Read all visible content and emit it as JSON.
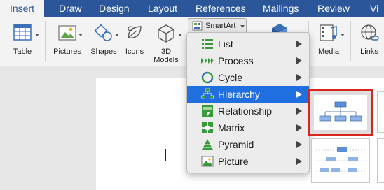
{
  "ribbon_tabs": [
    "Insert",
    "Draw",
    "Design",
    "Layout",
    "References",
    "Mailings",
    "Review",
    "Vi"
  ],
  "ribbon_buttons": {
    "table": "Table",
    "pictures": "Pictures",
    "shapes": "Shapes",
    "icons": "Icons",
    "models_line1": "3D",
    "models_line2": "Models",
    "media": "Media",
    "links": "Links"
  },
  "smartart_button": "SmartArt",
  "smartart_menu": {
    "selected": "Hierarchy",
    "items": [
      {
        "label": "List",
        "icon": "list-icon"
      },
      {
        "label": "Process",
        "icon": "process-icon"
      },
      {
        "label": "Cycle",
        "icon": "cycle-icon"
      },
      {
        "label": "Hierarchy",
        "icon": "hierarchy-icon"
      },
      {
        "label": "Relationship",
        "icon": "relationship-icon"
      },
      {
        "label": "Matrix",
        "icon": "matrix-icon"
      },
      {
        "label": "Pyramid",
        "icon": "pyramid-icon"
      },
      {
        "label": "Picture",
        "icon": "picture-icon"
      }
    ]
  },
  "colors": {
    "ribbon_tab_bar": "#2b579a",
    "menu_highlight": "#1f6fe0",
    "gallery_selection_border": "#d9251d"
  }
}
